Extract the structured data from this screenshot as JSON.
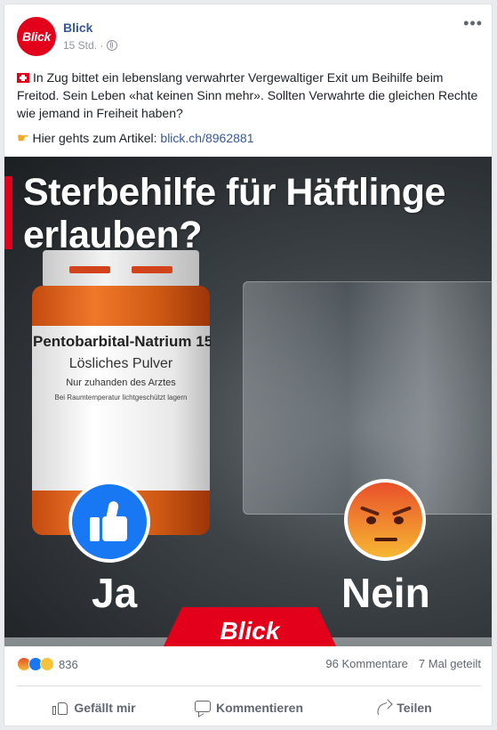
{
  "post": {
    "page_name": "Blick",
    "avatar_text": "Blick",
    "time": "15 Std. ·",
    "privacy_icon": "globe-icon",
    "text": "In Zug bittet ein lebenslang verwahrter Vergewaltiger Exit um Beihilfe beim Freitod. Sein Leben «hat keinen Sinn mehr». Sollten Verwahrte die gleichen Rechte wie jemand in Freiheit haben?",
    "link_prefix": "Hier gehts zum Artikel:",
    "link_text": "blick.ch/8962881"
  },
  "image": {
    "headline_line1": "Sterbehilfe für Häftlinge",
    "headline_line2": "erlauben?",
    "bottle_label_1": "Pentobarbital-Natrium 15",
    "bottle_label_2": "Lösliches Pulver",
    "bottle_label_3": "Nur zuhanden des Arztes",
    "bottle_label_4": "Bei Raumtemperatur lichtgeschützt lagern",
    "vote_yes": "Ja",
    "vote_no": "Nein",
    "brand": "Blick"
  },
  "stats": {
    "reactions_count": "836",
    "comments": "96 Kommentare",
    "shares": "7 Mal geteilt"
  },
  "actions": {
    "like": "Gefällt mir",
    "comment": "Kommentieren",
    "share": "Teilen"
  },
  "colors": {
    "brand_red": "#e2001a",
    "link_blue": "#365899",
    "like_blue": "#1877f2"
  }
}
